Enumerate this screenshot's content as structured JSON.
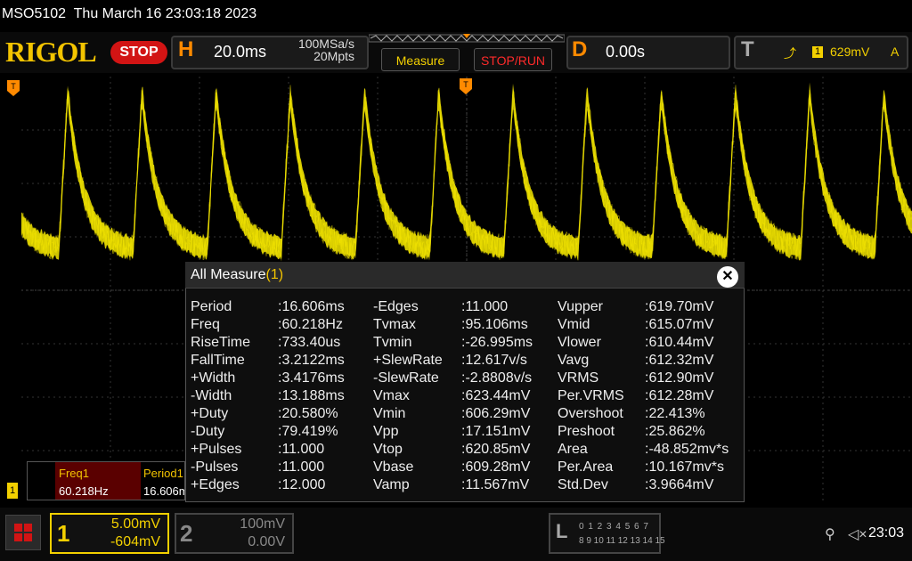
{
  "title_bar": "MSO5102  Thu March 16 23:03:18 2023",
  "header": {
    "logo": "RIGOL",
    "run_state": "STOP",
    "horizontal": {
      "letter": "H",
      "timebase": "20.0ms",
      "sample_rate": "100MSa/s",
      "memory_depth": "20Mpts"
    },
    "measure_button": "Measure",
    "stoprun_button": "STOP/RUN",
    "delay": {
      "letter": "D",
      "value": "0.00s"
    },
    "trigger": {
      "letter": "T",
      "edge_icon": "rising-edge-icon",
      "source": "1",
      "level": "629mV",
      "mode": "A"
    }
  },
  "channel_markers": {
    "ch1": "1"
  },
  "waveform": {
    "color": "#f3e600",
    "periods_shown": 12
  },
  "measure": {
    "title": "All Measure",
    "count": "(1)",
    "columns": [
      [
        {
          "label": "Period",
          "value": ":16.606ms"
        },
        {
          "label": "Freq",
          "value": ":60.218Hz"
        },
        {
          "label": "RiseTime",
          "value": ":733.40us"
        },
        {
          "label": "FallTime",
          "value": ":3.2122ms"
        },
        {
          "label": "+Width",
          "value": ":3.4176ms"
        },
        {
          "label": "-Width",
          "value": ":13.188ms"
        },
        {
          "label": "+Duty",
          "value": ":20.580%"
        },
        {
          "label": "-Duty",
          "value": ":79.419%"
        },
        {
          "label": "+Pulses",
          "value": ":11.000"
        },
        {
          "label": "-Pulses",
          "value": ":11.000"
        },
        {
          "label": "+Edges",
          "value": ":12.000"
        }
      ],
      [
        {
          "label": "-Edges",
          "value": ":11.000"
        },
        {
          "label": "Tvmax",
          "value": ":95.106ms"
        },
        {
          "label": "Tvmin",
          "value": ":-26.995ms"
        },
        {
          "label": "+SlewRate",
          "value": ":12.617v/s"
        },
        {
          "label": "-SlewRate",
          "value": ":-2.8808v/s"
        },
        {
          "label": "Vmax",
          "value": ":623.44mV"
        },
        {
          "label": "Vmin",
          "value": ":606.29mV"
        },
        {
          "label": "Vpp",
          "value": ":17.151mV"
        },
        {
          "label": "Vtop",
          "value": ":620.85mV"
        },
        {
          "label": "Vbase",
          "value": ":609.28mV"
        },
        {
          "label": "Vamp",
          "value": ":11.567mV"
        }
      ],
      [
        {
          "label": "Vupper",
          "value": ":619.70mV"
        },
        {
          "label": "Vmid",
          "value": ":615.07mV"
        },
        {
          "label": "Vlower",
          "value": ":610.44mV"
        },
        {
          "label": "Vavg",
          "value": ":612.32mV"
        },
        {
          "label": "VRMS",
          "value": ":612.90mV"
        },
        {
          "label": "Per.VRMS",
          "value": ":612.28mV"
        },
        {
          "label": "Overshoot",
          "value": ":22.413%"
        },
        {
          "label": "Preshoot",
          "value": ":25.862%"
        },
        {
          "label": "Area",
          "value": ":-48.852mv*s"
        },
        {
          "label": "Per.Area",
          "value": ":10.167mv*s"
        },
        {
          "label": "Std.Dev",
          "value": ":3.9664mV"
        }
      ]
    ]
  },
  "quick_measure": {
    "freq_label": "Freq1",
    "freq_value": "60.218Hz",
    "period_label": "Period1",
    "period_value": "16.606m"
  },
  "bottom": {
    "ch1": {
      "num": "1",
      "scale": "5.00mV",
      "offset": "-604mV"
    },
    "ch2": {
      "num": "2",
      "scale": "100mV",
      "offset": "0.00V"
    },
    "la": {
      "letter": "L",
      "row1": "0 1 2 3  4 5 6 7",
      "row2": "8 9 10 11 12 13 14 15"
    },
    "clock": "23:03"
  }
}
